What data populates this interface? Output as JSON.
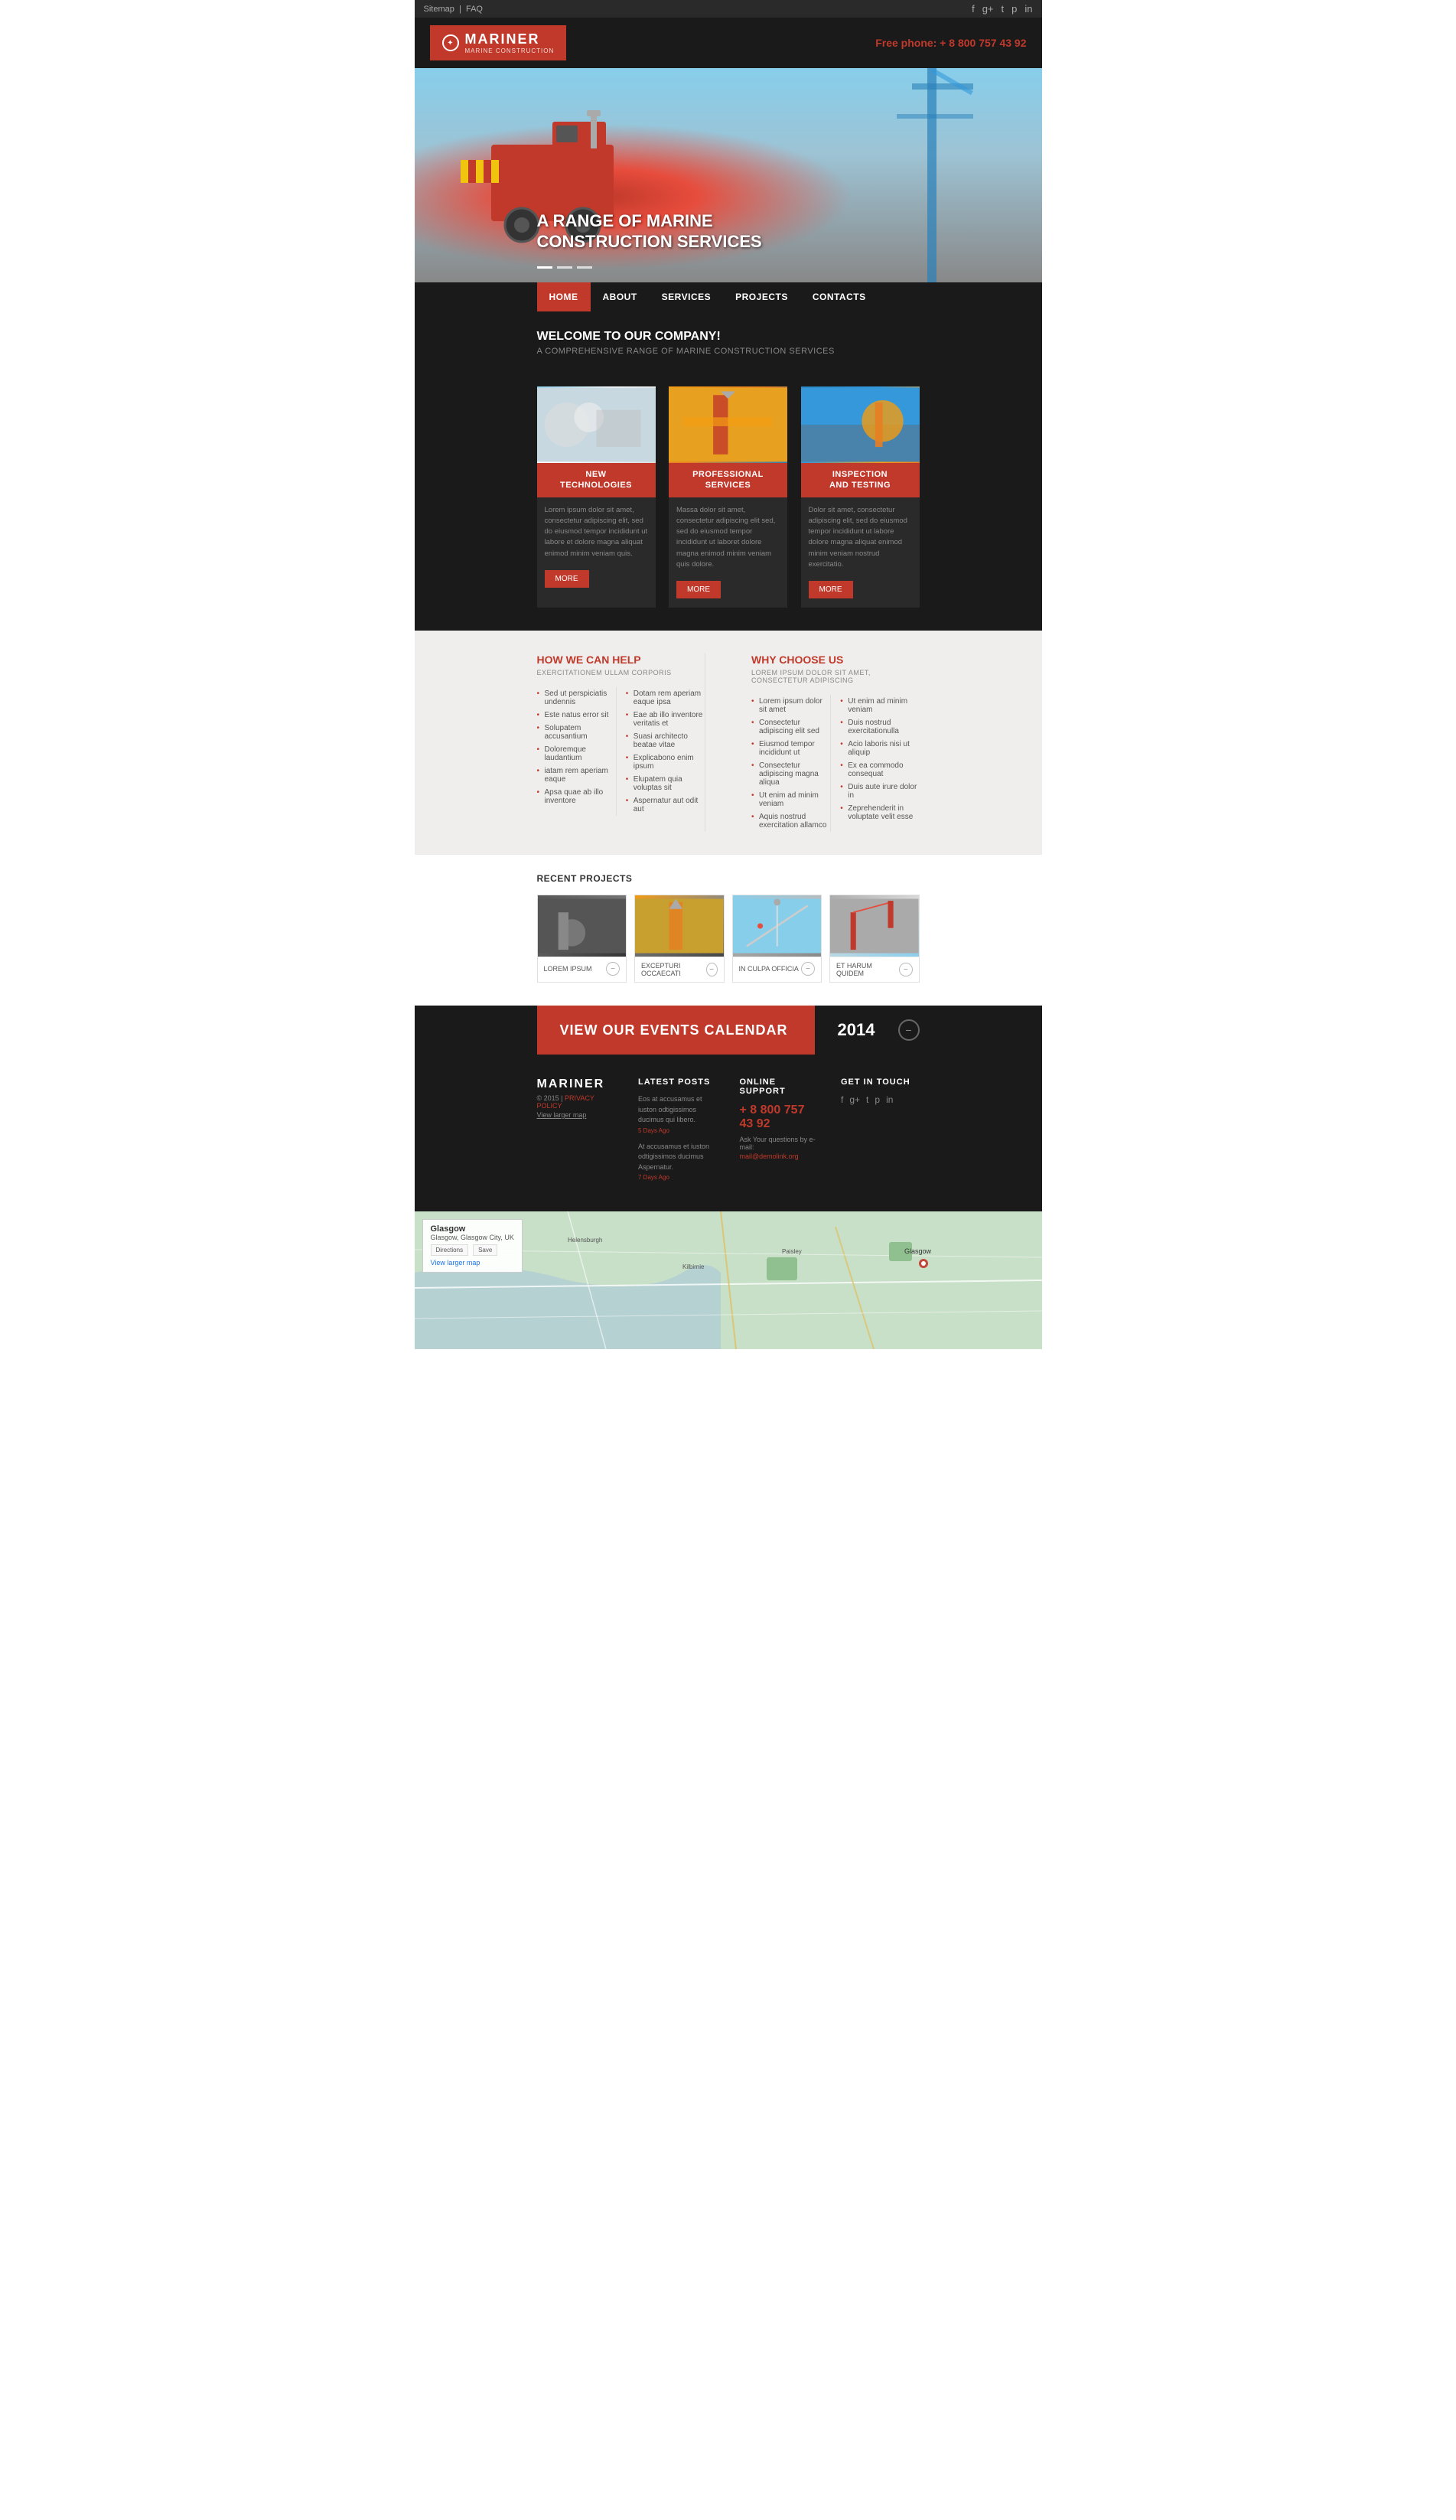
{
  "topbar": {
    "sitemap": "Sitemap",
    "faq": "FAQ",
    "social": [
      "f",
      "g+",
      "t",
      "p",
      "in"
    ]
  },
  "header": {
    "logo_brand": "MARINER",
    "logo_sub": "MARINE CONSTRUCTION",
    "phone_label": "Free phone:",
    "phone_number": "+ 8 800 757 43 92"
  },
  "hero": {
    "headline_line1": "A RANGE OF MARINE",
    "headline_line2": "CONSTRUCTION SERVICES"
  },
  "nav": {
    "items": [
      {
        "label": "HOME",
        "active": true
      },
      {
        "label": "ABOUT",
        "active": false
      },
      {
        "label": "SERVICES",
        "active": false
      },
      {
        "label": "PROJECTS",
        "active": false
      },
      {
        "label": "CONTACTS",
        "active": false
      }
    ]
  },
  "welcome": {
    "title": "WELCOME TO OUR COMPANY!",
    "subtitle": "A COMPREHENSIVE RANGE OF MARINE CONSTRUCTION SERVICES"
  },
  "services": [
    {
      "title": "NEW\nTECHNOLOGIES",
      "description": "Lorem ipsum dolor sit amet, consectetur adipiscing elit, sed do eiusmod tempor incididunt ut labore et dolore magna aliquat enimod minim veniam quis.",
      "btn": "MORE"
    },
    {
      "title": "PROFESSIONAL\nSERVICES",
      "description": "Massa dolor sit amet, consectetur adipiscing elit sed, sed do eiusmod tempor incididunt ut laboret dolore magna enimod minim veniam quis dolore.",
      "btn": "MORE"
    },
    {
      "title": "INSPECTION\nAND TESTING",
      "description": "Dolor sit amet, consectetur adipiscing elit, sed do eiusmod tempor incididunt ut labore dolore magna aliquat enimod minim veniam nostrud exercitatio.",
      "btn": "MORE"
    }
  ],
  "how_we_help": {
    "title": "HOW WE CAN HELP",
    "subtitle": "EXERCITATIONEM ULLAM CORPORIS",
    "col1": [
      "Sed ut perspiciatis undennis",
      "Este natus error sit",
      "Solupatem accusantium",
      "Doloremque laudantium",
      "iatam rem aperiam eaque",
      "Apsa quae ab illo inventore"
    ],
    "col2": [
      "Dotam rem aperiam eaque ipsa",
      "Eae ab illo inventore veritatis et",
      "Suasi architecto beatae vitae",
      "Explicabono enim ipsum",
      "Elupatem quia voluptas sit",
      "Aspernatur aut odit aut"
    ]
  },
  "why_choose": {
    "title": "WHY CHOOSE US",
    "subtitle": "LOREM IPSUM DOLOR SIT AMET, CONSECTETUR ADIPISCING",
    "col1": [
      "Lorem ipsum dolor sit amet",
      "Consectetur adipiscing elit sed",
      "Eiusmod tempor incididunt ut",
      "Consectetur adipiscing magna aliqua",
      "Ut enim ad minim veniam",
      "Aquis nostrud exercitation allamco"
    ],
    "col2": [
      "Ut enim ad minim veniam",
      "Duis nostrud exercitationulla",
      "Acio laboris nisi ut aliquip",
      "Ex ea commodo consequat",
      "Duis aute irure dolor in",
      "Zeprehenderit in voluptate velit esse"
    ]
  },
  "projects": {
    "title": "RECENT PROJECTS",
    "items": [
      {
        "label": "LOREM IPSUM"
      },
      {
        "label": "EXCEPTURI OCCAECATI"
      },
      {
        "label": "IN CULPA OFFICIA"
      },
      {
        "label": "ET HARUM QUIDEM"
      }
    ]
  },
  "events": {
    "banner_text": "VIEW OUR EVENTS CALENDAR",
    "year": "2014"
  },
  "footer": {
    "brand": "MARINER",
    "copyright": "© 2015 |",
    "privacy": "PRIVACY POLICY",
    "map_link": "View larger map",
    "latest_posts_title": "LATEST POSTS",
    "posts": [
      {
        "text": "Eos at accusamus et iuston odtigissimos ducimus qui libero.",
        "date": "5 Days Ago"
      },
      {
        "text": "At accusamus et iuston odtigissimos ducimus Aspernatur.",
        "date": "7 Days Ago"
      }
    ],
    "support_title": "ONLINE SUPPORT",
    "support_phone": "+ 8 800 757 43 92",
    "support_text": "Ask Your questions by e-mail:",
    "support_email": "mail@demolink.org",
    "contact_title": "GET IN TOUCH",
    "social_icons": [
      "f",
      "g+",
      "t",
      "p",
      "in"
    ]
  },
  "map": {
    "city": "Glasgow",
    "city_detail": "Glasgow, Glasgow City, UK",
    "directions_btn": "Directions",
    "save_btn": "Save",
    "view_larger": "View larger map",
    "label": "Glasgow"
  }
}
